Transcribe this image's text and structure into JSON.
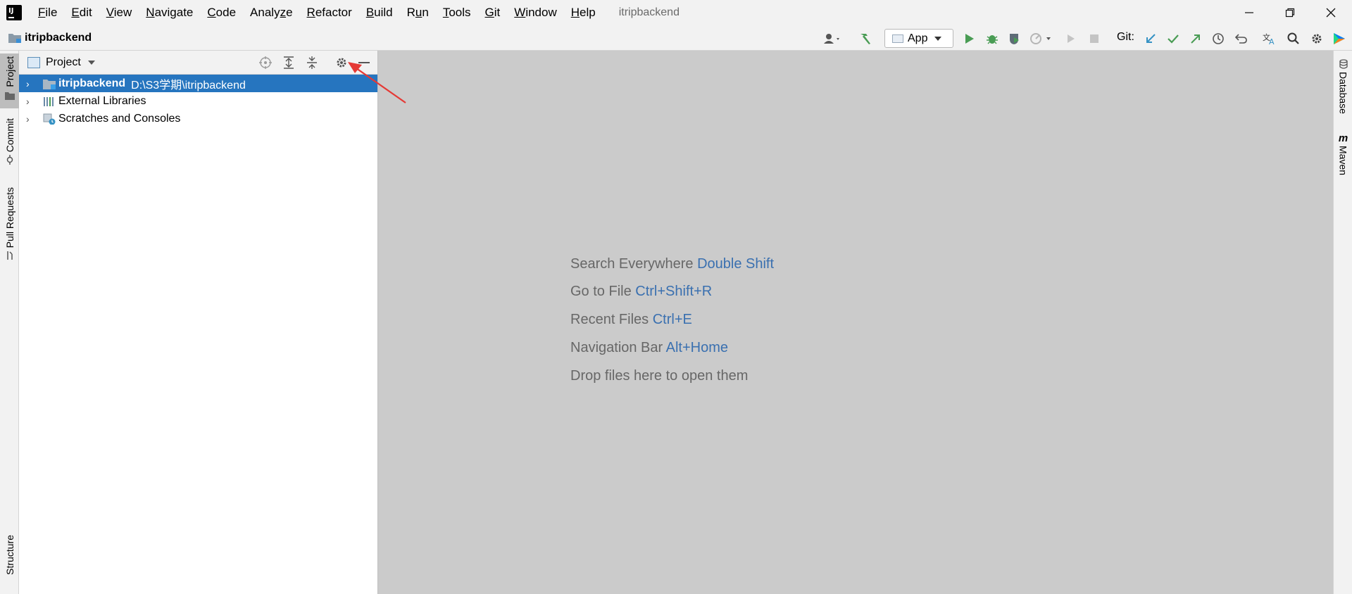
{
  "menubar": {
    "items": [
      {
        "label": "File",
        "mnemonic": "F"
      },
      {
        "label": "Edit",
        "mnemonic": "E"
      },
      {
        "label": "View",
        "mnemonic": "V"
      },
      {
        "label": "Navigate",
        "mnemonic": "N"
      },
      {
        "label": "Code",
        "mnemonic": "C"
      },
      {
        "label": "Analyze",
        "mnemonic": "z"
      },
      {
        "label": "Refactor",
        "mnemonic": "R"
      },
      {
        "label": "Build",
        "mnemonic": "B"
      },
      {
        "label": "Run",
        "mnemonic": "u"
      },
      {
        "label": "Tools",
        "mnemonic": "T"
      },
      {
        "label": "Git",
        "mnemonic": "G"
      },
      {
        "label": "Window",
        "mnemonic": "W"
      },
      {
        "label": "Help",
        "mnemonic": "H"
      }
    ],
    "window_title": "itripbackend"
  },
  "navbar": {
    "project_name": "itripbackend",
    "run_config": "App",
    "git_label": "Git:"
  },
  "left_strip": {
    "tabs": [
      "Project",
      "Commit",
      "Pull Requests",
      "Structure"
    ]
  },
  "right_strip": {
    "tabs": [
      "Database",
      "Maven"
    ]
  },
  "project_panel": {
    "title": "Project",
    "tree": [
      {
        "name": "itripbackend",
        "path": "D:\\S3学期\\itripbackend",
        "selected": true
      },
      {
        "name": "External Libraries",
        "path": "",
        "selected": false
      },
      {
        "name": "Scratches and Consoles",
        "path": "",
        "selected": false
      }
    ]
  },
  "editor": {
    "hints": [
      {
        "text": "Search Everywhere",
        "key": "Double Shift"
      },
      {
        "text": "Go to File",
        "key": "Ctrl+Shift+R"
      },
      {
        "text": "Recent Files",
        "key": "Ctrl+E"
      },
      {
        "text": "Navigation Bar",
        "key": "Alt+Home"
      },
      {
        "text": "Drop files here to open them",
        "key": ""
      }
    ]
  },
  "colors": {
    "selection": "#2675bf",
    "editor_bg": "#cbcbcb",
    "hint_key": "#3a70b0",
    "run_green": "#499c54",
    "git_blue": "#3592c4",
    "annotation_red": "#e53935"
  }
}
